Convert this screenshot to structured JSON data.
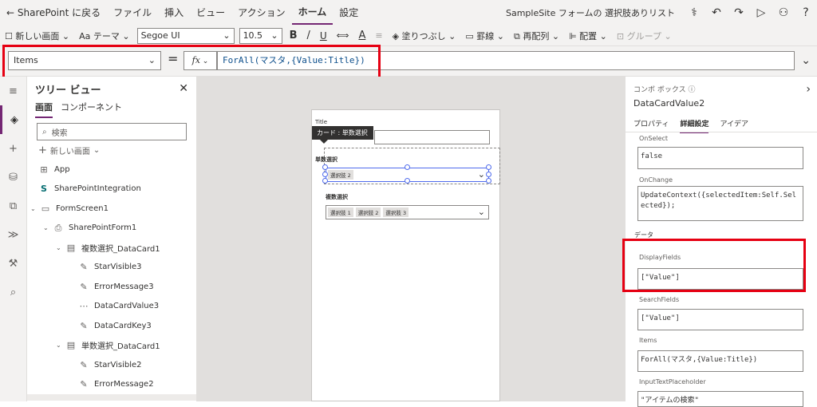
{
  "menubar": {
    "back": "SharePoint に戻る",
    "items": [
      "ファイル",
      "挿入",
      "ビュー",
      "アクション",
      "ホーム",
      "設定"
    ],
    "active": "ホーム",
    "app_title": "SampleSite フォームの 選択肢ありリスト"
  },
  "toolbar": {
    "new_screen": "新しい画面",
    "theme": "テーマ",
    "font": "Segoe UI",
    "font_size": "10.5",
    "bold": "B",
    "italic": "/",
    "underline": "U",
    "strike": "⟺",
    "font_color": "A",
    "fill": "塗りつぶし",
    "border": "罫線",
    "reorder": "再配列",
    "align": "配置",
    "group": "グループ"
  },
  "formula": {
    "property": "Items",
    "equals": "=",
    "fx": "fx",
    "text": "ForAll(マスタ,{Value:Title})"
  },
  "tree": {
    "title": "ツリー ビュー",
    "tabs": [
      "画面",
      "コンポーネント"
    ],
    "search_placeholder": "検索",
    "new_screen": "新しい画面",
    "nodes": [
      {
        "label": "App",
        "icon": "app-icon"
      },
      {
        "label": "SharePointIntegration",
        "icon": "sharepoint-icon"
      },
      {
        "label": "FormScreen1",
        "icon": "screen-icon"
      },
      {
        "label": "SharePointForm1",
        "icon": "form-icon"
      },
      {
        "label": "複数選択_DataCard1",
        "icon": "card-icon"
      },
      {
        "label": "StarVisible3",
        "icon": "edit-icon"
      },
      {
        "label": "ErrorMessage3",
        "icon": "edit-icon"
      },
      {
        "label": "DataCardValue3",
        "icon": "combobox-icon"
      },
      {
        "label": "DataCardKey3",
        "icon": "edit-icon"
      },
      {
        "label": "単数選択_DataCard1",
        "icon": "card-icon"
      },
      {
        "label": "StarVisible2",
        "icon": "edit-icon"
      },
      {
        "label": "ErrorMessage2",
        "icon": "edit-icon"
      }
    ]
  },
  "canvas": {
    "title_label": "Title",
    "tooltip": "カード : 単数選択",
    "single_label": "単数選択",
    "single_chip": "選択肢 2",
    "multi_label": "複数選択",
    "multi_chips": [
      "選択肢 1",
      "選択肢 2",
      "選択肢 3"
    ]
  },
  "panel": {
    "control_type": "コンボ ボックス",
    "control_name": "DataCardValue2",
    "tabs": [
      "プロパティ",
      "詳細設定",
      "アイデア"
    ],
    "onselect_label": "OnSelect",
    "onselect_value": "false",
    "onchange_label": "OnChange",
    "onchange_value": "UpdateContext({selectedItem:Self.Selected});",
    "data_section": "データ",
    "displayfields_label": "DisplayFields",
    "displayfields_value": "[\"Value\"]",
    "searchfields_label": "SearchFields",
    "searchfields_value": "[\"Value\"]",
    "items_label": "Items",
    "items_value": "ForAll(マスタ,{Value:Title})",
    "placeholder_label": "InputTextPlaceholder",
    "placeholder_value": "\"アイテムの検索\""
  },
  "colors": {
    "accent": "#742774",
    "highlight": "#e60012",
    "selection": "#4f6bed"
  }
}
